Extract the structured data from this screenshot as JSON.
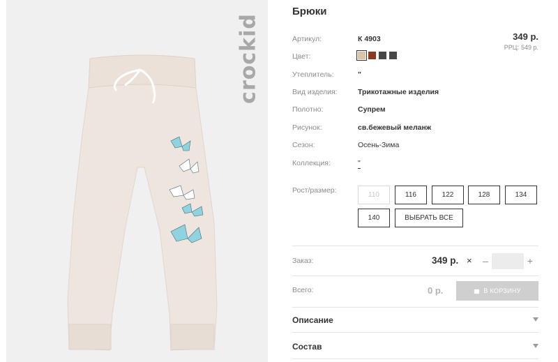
{
  "brand": {
    "logo_text": "crockid",
    "logo_icon": "crockid-logo"
  },
  "product": {
    "title": "Брюки",
    "image_alt": "Бежевые трикотажные брюки с бабочками"
  },
  "price": {
    "main": "349 р.",
    "rrp_label": "РРЦ:",
    "rrp_value": "549 р."
  },
  "attributes": {
    "article": {
      "label": "Артикул:",
      "value": "К 4903"
    },
    "color": {
      "label": "Цвет:",
      "swatches": [
        "#d9c6a7",
        "#8b3a22",
        "#474747",
        "#474747"
      ],
      "selected_index": 0
    },
    "insulation": {
      "label": "Утеплитель:",
      "value": "\""
    },
    "type": {
      "label": "Вид изделия:",
      "value": "Трикотажные изделия"
    },
    "fabric": {
      "label": "Полотно:",
      "value": "Супрем"
    },
    "pattern": {
      "label": "Рисунок:",
      "value": "св.бежевый меланж"
    },
    "season": {
      "label": "Сезон:",
      "value": "Осень-Зима"
    },
    "collection": {
      "label": "Коллекция:",
      "value": "\""
    }
  },
  "sizes": {
    "label": "Рост/размер:",
    "options": [
      {
        "label": "110",
        "disabled": true
      },
      {
        "label": "116",
        "disabled": false
      },
      {
        "label": "122",
        "disabled": false
      },
      {
        "label": "128",
        "disabled": false
      },
      {
        "label": "134",
        "disabled": false
      },
      {
        "label": "140",
        "disabled": false
      }
    ],
    "select_all": "ВЫБРАТЬ ВСЕ"
  },
  "order": {
    "label": "Заказ:",
    "price": "349 р.",
    "times": "×",
    "minus": "–",
    "plus": "+",
    "quantity": "",
    "quantity_placeholder": ""
  },
  "total": {
    "label": "Всего:",
    "value": "0 р.",
    "cart_button": "В КОРЗИНУ",
    "cart_icon": "cart-icon"
  },
  "sections": [
    {
      "title": "Описание"
    },
    {
      "title": "Состав"
    }
  ],
  "colors": {
    "text": "#333333",
    "muted": "#8a8a8a",
    "panel_bg": "#f0f0f0",
    "button_disabled": "#cfcfcf",
    "butterfly": "#8fd3e0"
  }
}
